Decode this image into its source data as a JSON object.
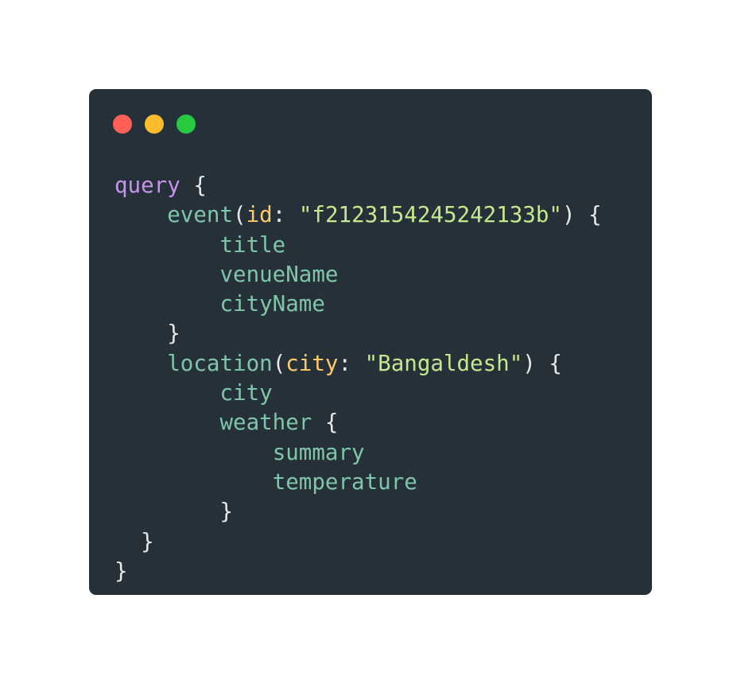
{
  "window": {
    "controls": [
      {
        "name": "close",
        "color": "#ff5f56"
      },
      {
        "name": "minimize",
        "color": "#ffbd2e"
      },
      {
        "name": "maximize",
        "color": "#27c93f"
      }
    ]
  },
  "code": {
    "lines": [
      [
        {
          "t": "kw",
          "v": "query"
        },
        {
          "t": "punc",
          "v": " {"
        }
      ],
      [
        {
          "t": "punc",
          "v": "    "
        },
        {
          "t": "field",
          "v": "event"
        },
        {
          "t": "punc",
          "v": "("
        },
        {
          "t": "arg",
          "v": "id"
        },
        {
          "t": "punc",
          "v": ": "
        },
        {
          "t": "str",
          "v": "\"f2123154245242133b\""
        },
        {
          "t": "punc",
          "v": ") {"
        }
      ],
      [
        {
          "t": "punc",
          "v": "        "
        },
        {
          "t": "field",
          "v": "title"
        }
      ],
      [
        {
          "t": "punc",
          "v": "        "
        },
        {
          "t": "field",
          "v": "venueName"
        }
      ],
      [
        {
          "t": "punc",
          "v": "        "
        },
        {
          "t": "field",
          "v": "cityName"
        }
      ],
      [
        {
          "t": "punc",
          "v": "    }"
        }
      ],
      [
        {
          "t": "punc",
          "v": "    "
        },
        {
          "t": "field",
          "v": "location"
        },
        {
          "t": "punc",
          "v": "("
        },
        {
          "t": "arg",
          "v": "city"
        },
        {
          "t": "punc",
          "v": ": "
        },
        {
          "t": "str",
          "v": "\"Bangaldesh\""
        },
        {
          "t": "punc",
          "v": ") {"
        }
      ],
      [
        {
          "t": "punc",
          "v": "        "
        },
        {
          "t": "field",
          "v": "city"
        }
      ],
      [
        {
          "t": "punc",
          "v": "        "
        },
        {
          "t": "field",
          "v": "weather"
        },
        {
          "t": "punc",
          "v": " {"
        }
      ],
      [
        {
          "t": "punc",
          "v": "            "
        },
        {
          "t": "field",
          "v": "summary"
        }
      ],
      [
        {
          "t": "punc",
          "v": "            "
        },
        {
          "t": "field",
          "v": "temperature"
        }
      ],
      [
        {
          "t": "punc",
          "v": "        }"
        }
      ],
      [
        {
          "t": "punc",
          "v": "  }"
        }
      ],
      [
        {
          "t": "punc",
          "v": "}"
        }
      ]
    ]
  }
}
